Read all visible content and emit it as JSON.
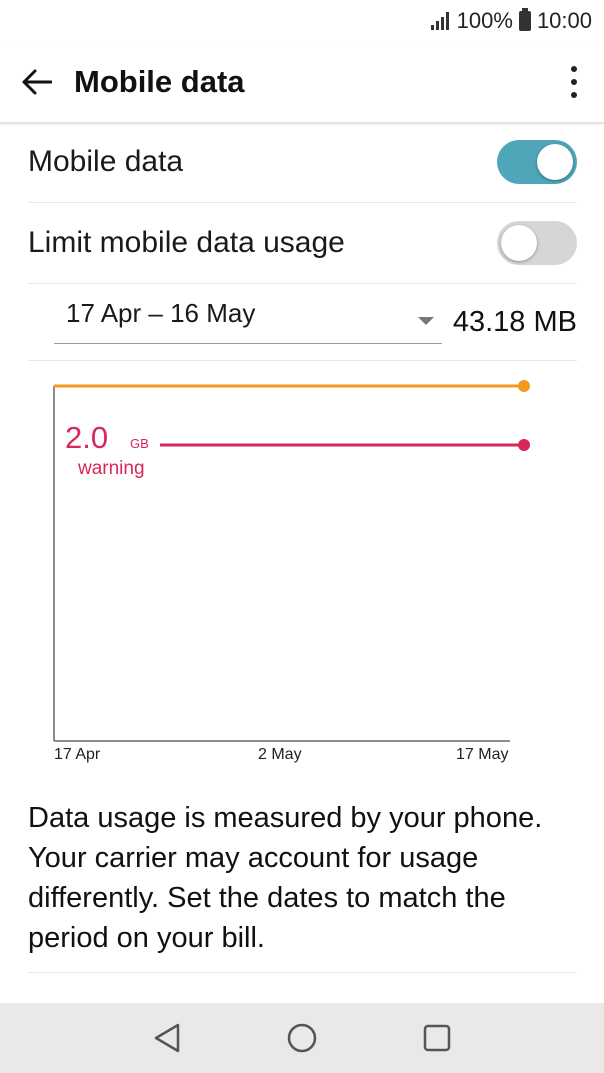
{
  "status_bar": {
    "battery": "100%",
    "time": "10:00"
  },
  "app_bar": {
    "title": "Mobile data",
    "back_icon": "arrow-left-icon",
    "menu_icon": "more-vert-icon"
  },
  "settings": {
    "mobile_data": {
      "label": "Mobile data",
      "enabled": true
    },
    "limit_usage": {
      "label": "Limit mobile data usage",
      "enabled": false
    }
  },
  "usage": {
    "date_range": "17 Apr – 16 May",
    "total": "43.18 MB"
  },
  "chart_data": {
    "type": "line",
    "x_ticks": [
      "17 Apr",
      "2 May",
      "17 May"
    ],
    "warning": {
      "value": "2.0",
      "unit": "GB",
      "label": "warning",
      "color": "#d6285a"
    },
    "limit_line_color": "#f39a1e",
    "usage_line_color": "#4fa6b8"
  },
  "info_text": "Data usage is measured by your phone. Your carrier may account for usage differently. Set the dates to match the period on your bill.",
  "nav": {
    "back": "triangle-back-icon",
    "home": "circle-home-icon",
    "recents": "square-recents-icon"
  }
}
